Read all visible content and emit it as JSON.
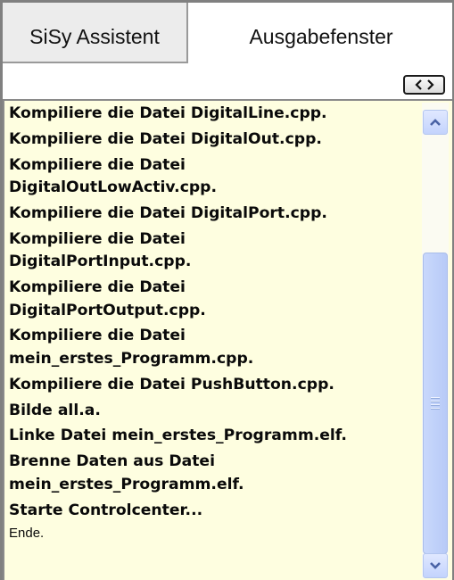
{
  "tabs": [
    {
      "label": "SiSy Assistent",
      "active": false
    },
    {
      "label": "Ausgabefenster",
      "active": true
    }
  ],
  "toolbar": {
    "expand_icon": "expand-collapse-icon"
  },
  "output": {
    "lines": [
      "Kompiliere die Datei DigitalLine.cpp.",
      "Kompiliere die Datei DigitalOut.cpp.",
      "Kompiliere die Datei\nDigitalOutLowActiv.cpp.",
      "Kompiliere die Datei DigitalPort.cpp.",
      "Kompiliere die Datei\nDigitalPortInput.cpp.",
      "Kompiliere die Datei\nDigitalPortOutput.cpp.",
      "Kompiliere die Datei\nmein_erstes_Programm.cpp.",
      "Kompiliere die Datei PushButton.cpp.",
      "Bilde all.a.",
      "Linke Datei mein_erstes_Programm.elf.",
      "Brenne Daten aus Datei\nmein_erstes_Programm.elf.",
      "Starte Controlcenter..."
    ],
    "last_line": "Ende.",
    "background": "#fefee0"
  },
  "colors": {
    "scroll_thumb": "#c4d5fb",
    "scroll_arrow": "#4a63a6"
  }
}
